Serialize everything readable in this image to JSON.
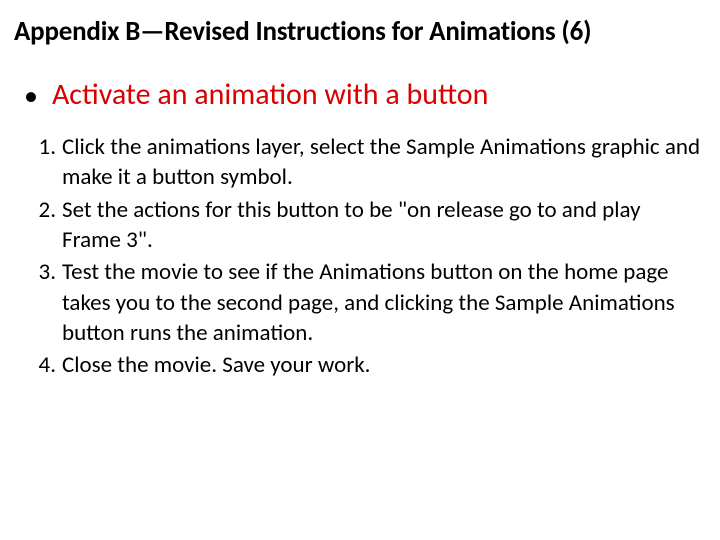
{
  "title": "Appendix B—Revised Instructions for Animations (6)",
  "bullet": "Activate an animation with a button",
  "steps": [
    {
      "n": "1.",
      "t": "Click the animations layer, select the Sample Animations graphic and make it a button symbol."
    },
    {
      "n": "2.",
      "t": "Set the actions for this button to be \"on release go to and play Frame 3\"."
    },
    {
      "n": "3.",
      "t": "Test the movie to see if the Animations button on the home page takes you to the second page, and clicking the Sample Animations button runs the animation."
    },
    {
      "n": "4.",
      "t": "Close the movie. Save your work."
    }
  ]
}
